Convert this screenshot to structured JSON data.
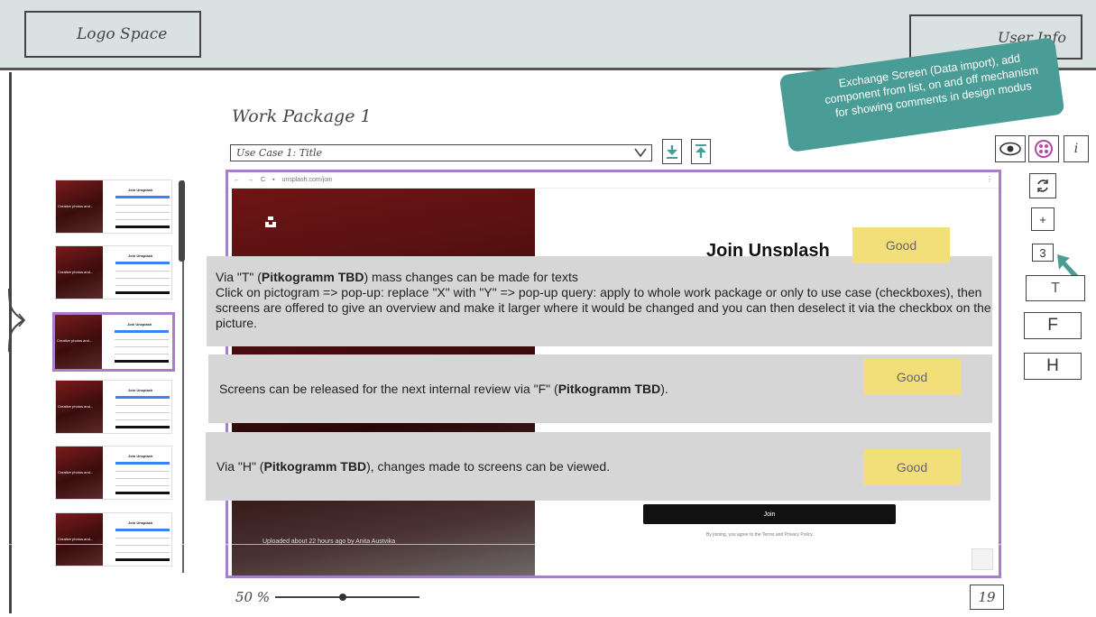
{
  "header": {
    "logo_label": "Logo Space",
    "user_label": "User Info"
  },
  "workpackage": {
    "title": "Work Package 1",
    "use_case_selected": "Use Case 1: Title"
  },
  "annotation": {
    "text": "Exchange Screen (Data import), add component from list, on and off mechanism for showing comments in design modus",
    "color": "#4a9d96"
  },
  "right_toolbar": {
    "comments_count": "3",
    "tool_t": "T",
    "tool_f": "F",
    "tool_h": "H",
    "add_label": "+",
    "info_label": "i",
    "accent": "#4a9d96"
  },
  "screenshot": {
    "url": "unsplash.com/join",
    "heading": "Join Unsplash",
    "join_button": "Join",
    "terms": "By joining, you agree to the Terms and Privacy Policy.",
    "photo_credit": "Uploaded about 22 hours ago by Anita Austvika",
    "frame_color": "#a77fc9"
  },
  "thumbnails": {
    "title": "Join Unsplash",
    "photo_caption": "Creative photos and...",
    "count": 6,
    "active_index": 2
  },
  "notes": {
    "t": {
      "prefix": "Via \"T\" (",
      "bold": "Pitkogramm TBD",
      "suffix": ") mass changes can be made for texts",
      "body": "Click on pictogram => pop-up: replace \"X\" with \"Y\" => pop-up query: apply to whole work package or only to use case (checkboxes), then screens are offered to give an overview and make it larger where it would be changed and you can then deselect it via the checkbox on the picture."
    },
    "f": {
      "prefix": "Screens can be released for the next internal review via \"F\" (",
      "bold": "Pitkogramm TBD",
      "suffix": ")."
    },
    "h": {
      "prefix": "Via \"H\" (",
      "bold": "Pitkogramm TBD",
      "suffix": "), changes made to screens can be viewed."
    },
    "good_label": "Good",
    "good_color": "#f2df7a"
  },
  "footer": {
    "zoom": "50 %",
    "zoom_value": 50,
    "page_count": "19"
  }
}
